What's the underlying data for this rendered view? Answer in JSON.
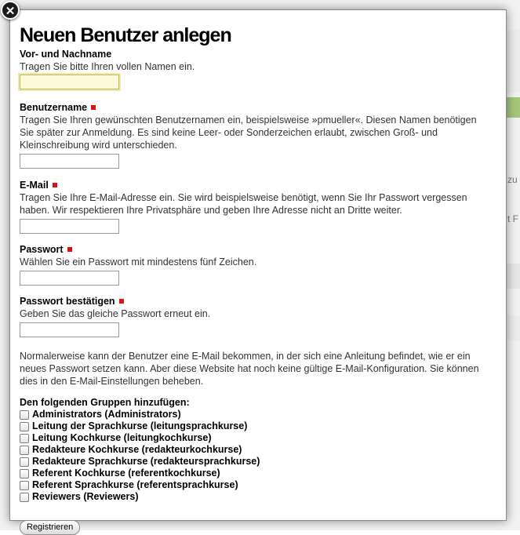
{
  "background": {
    "snippets": [
      "zu",
      "t F"
    ]
  },
  "dialog": {
    "close_glyph": "✕",
    "title": "Neuen Benutzer anlegen",
    "fields": [
      {
        "label": "Vor- und Nachname",
        "required": false,
        "description": "Tragen Sie bitte Ihren vollen Namen ein.",
        "value": ""
      },
      {
        "label": "Benutzername",
        "required": true,
        "description": "Tragen Sie Ihren gewünschten Benutzernamen ein, beispielsweise »pmueller«. Diesen Namen benötigen Sie später zur Anmeldung. Es sind keine Leer- oder Sonderzeichen erlaubt, zwischen Groß- und Kleinschreibung wird unterschieden.",
        "value": ""
      },
      {
        "label": "E-Mail",
        "required": true,
        "description": "Tragen Sie Ihre E-Mail-Adresse ein. Sie wird beispielsweise benötigt, wenn Sie Ihr Passwort vergessen haben. Wir respektieren Ihre Privatsphäre und geben Ihre Adresse nicht an Dritte weiter.",
        "value": ""
      },
      {
        "label": "Passwort",
        "required": true,
        "description": "Wählen Sie ein Passwort mit mindestens fünf Zeichen.",
        "value": ""
      },
      {
        "label": "Passwort bestätigen",
        "required": true,
        "description": "Geben Sie das gleiche Passwort erneut ein.",
        "value": ""
      }
    ],
    "info_text": "Normalerweise kann der Benutzer eine E-Mail bekommen, in der sich eine Anleitung befindet, wie er ein neues Passwort setzen kann. Aber diese Website hat noch keine gültige E-Mail-Konfiguration. Sie können dies in den E-Mail-Einstellungen beheben.",
    "groups_title": "Den folgenden Gruppen hinzufügen:",
    "groups": [
      {
        "label": "Administrators (Administrators)",
        "checked": false
      },
      {
        "label": "Leitung der Sprachkurse (leitungsprachkurse)",
        "checked": false
      },
      {
        "label": "Leitung Kochkurse (leitungkochkurse)",
        "checked": false
      },
      {
        "label": "Redakteure Kochkurse (redakteurkochkurse)",
        "checked": false
      },
      {
        "label": "Redakteure Sprachkurse (redakteursprachkurse)",
        "checked": false
      },
      {
        "label": "Referent Kochkurse (referentkochkurse)",
        "checked": false
      },
      {
        "label": "Referent Sprachkurse (referentsprachkurse)",
        "checked": false
      },
      {
        "label": "Reviewers (Reviewers)",
        "checked": false
      }
    ],
    "submit_label": "Registrieren"
  },
  "colors": {
    "required_marker": "#e01010",
    "background_accent": "#a5c77a"
  }
}
